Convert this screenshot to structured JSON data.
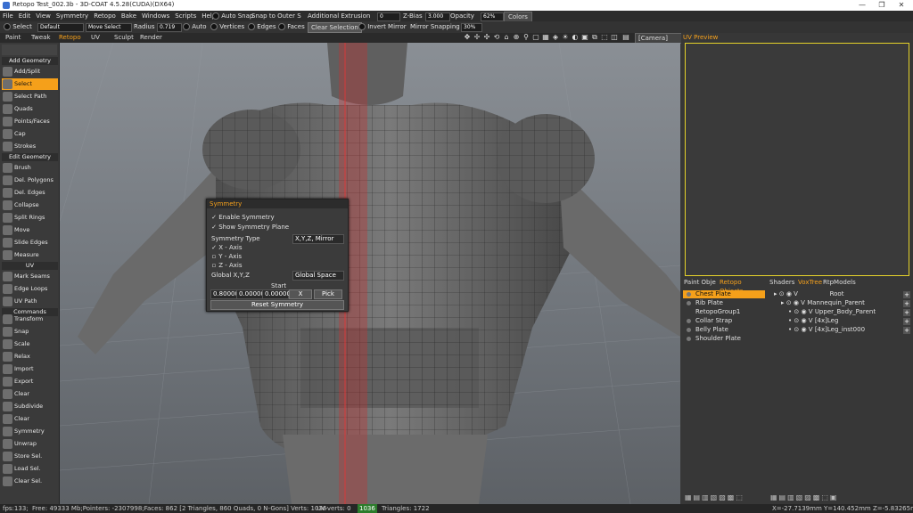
{
  "window": {
    "title": "Retopo Test_002.3b - 3D-COAT 4.5.28(CUDA)(DX64)",
    "min": "—",
    "max": "❐",
    "close": "✕"
  },
  "menu": [
    "File",
    "Edit",
    "View",
    "Symmetry",
    "Retopo",
    "Bake",
    "Windows",
    "Scripts",
    "Help"
  ],
  "topbar": {
    "auto_snap": "Auto Snap",
    "snap_outer": "Snap to Outer S",
    "additional_extrusion": "Additional Extrusion",
    "extrusion_value": "0",
    "zbias_label": "Z-Bias",
    "zbias_value": "3.000",
    "opacity_label": "Opacity",
    "opacity_value": "62%",
    "colors_label": "Colors"
  },
  "toolrow": {
    "select": "Select",
    "preset": "Default",
    "move_select": "Move Select",
    "radius_label": "Radius",
    "radius_value": "0.719",
    "auto": "Auto",
    "vertices": "Vertices",
    "edges": "Edges",
    "faces": "Faces",
    "clear_selection": "Clear Selection",
    "invert_mirror": "Invert Mirror",
    "mirror_snapping": "Mirror Snapping",
    "mirror_value": "30%"
  },
  "rooms": {
    "tabs": [
      "Paint",
      "Tweak",
      "Retopo",
      "UV",
      "Sculpt",
      "Render"
    ],
    "active": "Retopo",
    "camera": "[Camera]"
  },
  "left_tools": {
    "add_geometry": "Add Geometry",
    "add_tools": [
      "Add/Split",
      "Select",
      "Select Path",
      "Quads",
      "Points/Faces",
      "Cap",
      "Strokes"
    ],
    "edit_geometry": "Edit Geometry",
    "edit_tools": [
      "Brush",
      "Del. Polygons",
      "Del. Edges",
      "Collapse",
      "Split Rings",
      "Move",
      "Slide Edges",
      "Measure"
    ],
    "uv": "UV",
    "uv_tools": [
      "Mark Seams",
      "Edge Loops",
      "UV Path"
    ],
    "commands": "Commands",
    "command_tools": [
      "Transform",
      "Snap",
      "Scale",
      "Relax",
      "Import",
      "Export",
      "Clear",
      "Subdivide",
      "Clear",
      "Symmetry",
      "Unwrap",
      "Store Sel.",
      "Load Sel.",
      "Clear Sel."
    ]
  },
  "symmetry_panel": {
    "title": "Symmetry",
    "enable": "Enable Symmetry",
    "show_plane": "Show Symmetry Plane",
    "type_label": "Symmetry Type",
    "type_value": "X,Y,Z, Mirror",
    "x_axis": "X - Axis",
    "y_axis": "Y - Axis",
    "z_axis": "Z - Axis",
    "global_label": "Global X,Y,Z",
    "space_value": "Global Space",
    "start_label": "Start",
    "x_val": "0.80000",
    "y_val": "0.00000",
    "z_val": "0.00000",
    "x_btn": "X",
    "pick_btn": "Pick",
    "reset": "Reset Symmetry"
  },
  "uv_preview": {
    "title": "UV Preview"
  },
  "objects_panel": {
    "tabs": [
      "Paint Obje",
      "Retopo Objects"
    ],
    "active": "Retopo Objects",
    "items": [
      "Chest Plate",
      "Rib Plate",
      "RetopoGroup1",
      "Collar Strap",
      "Belly Plate",
      "Shoulder Plate"
    ],
    "selected": "Chest Plate"
  },
  "vox_panel": {
    "tabs": [
      "Shaders",
      "VoxTree",
      "RtpModels"
    ],
    "active": "VoxTree",
    "tree": [
      "Root",
      "Mannequin_Parent",
      "Upper_Body_Parent",
      "[4x]Leg",
      "[4x]Leg_inst000"
    ],
    "v": "V"
  },
  "status": {
    "fps": "fps:133;",
    "free": "Free: 49333 Mb;Pointers: -2307998;Faces: 862 [2 Triangles, 860 Quads, 0 N-Gons] Verts: 1036",
    "uv_verts_label": "UV-verts: 0",
    "uv_verts_highlight": "1036",
    "triangles": "Triangles: 1722",
    "coords": "X=-27.7139mm  Y=140.452mm  Z=-5.83265mm"
  },
  "colors": {
    "accent": "#f5a01a",
    "uv_frame": "#e5d22a",
    "symmetry_plane": "#c83030"
  }
}
